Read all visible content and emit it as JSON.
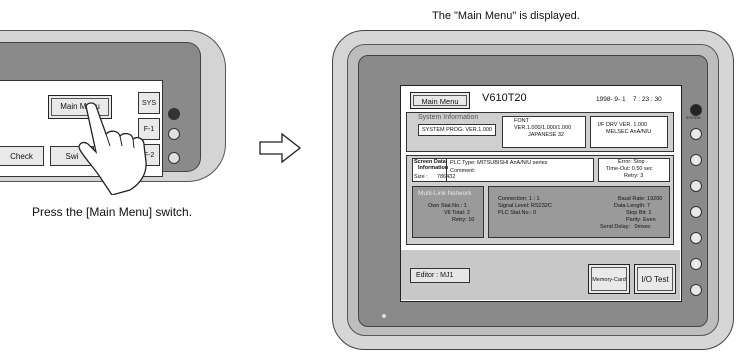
{
  "captions": {
    "left": "Press the [Main Menu] switch.",
    "right": "The \"Main Menu\" is displayed."
  },
  "left_device": {
    "main_menu_label": "Main Menu",
    "side_buttons": [
      "SYS",
      "F-1",
      "F-2"
    ],
    "bottom_buttons": [
      "Check",
      "Swi"
    ]
  },
  "screen": {
    "title_button": "Main Menu",
    "model": "V610T20",
    "datetime": "1998- 9- 1    7 : 23 : 30",
    "system_info": {
      "heading": "System Information",
      "prog_ver": "SYSTEM PROG. VER.1.000",
      "font_label": "FONT",
      "font_ver": "VER.1.000/1.000/1.000",
      "font_lang": "JAPANESE  32",
      "if_drv": "I/F DRV VER. 1.000",
      "melsec": "MELSEC AnA/N/U"
    },
    "screen_data": {
      "heading_line1": "Screen Data",
      "heading_line2": "Information",
      "size": "Size :      786432",
      "plc_type": "PLC Type: MITSUBISHI AnA/N/U series",
      "comment": "Comment:",
      "error": "Error: Stop",
      "timeout": "Time-Out: 0.50  sec",
      "retry": "Retry: 3"
    },
    "network": {
      "heading": "Multi-Link Network",
      "own_stat": "Own Stat.No.: 1",
      "v6_total": "V6 Total: 2",
      "retry": "Retry: 10",
      "connection": "Connection: 1 : 1",
      "signal": "Signal Level: RS232C",
      "plc_stat": "PLC Stat.No.: 0",
      "baud": "Baud Rate: 19200",
      "data_length": "Data Length: 7",
      "stop_bit": "Stop Bit: 1",
      "parity": "Parity: Even",
      "send_delay": "Send Delay:   0msec"
    },
    "editor": "Editor : MJ1",
    "memory_card": "Memory-Card",
    "io_test": "I/O Test"
  },
  "right_side_button_label": "SYSTEM",
  "icons": {
    "hand": "pointing-hand-icon",
    "arrow": "right-arrow-icon"
  }
}
